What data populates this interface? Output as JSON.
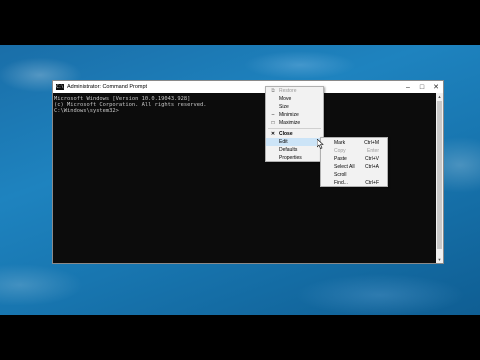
{
  "window": {
    "title": "Administrator: Command Prompt",
    "icon_text": "C:\\"
  },
  "console": {
    "lines": [
      "Microsoft Windows [Version 10.0.19043.928]",
      "(c) Microsoft Corporation. All rights reserved.",
      "",
      "C:\\Windows\\system32>"
    ]
  },
  "system_menu": {
    "items": [
      {
        "label": "Restore",
        "icon": "restore-icon",
        "glyph": "⧉",
        "disabled": true
      },
      {
        "label": "Move",
        "icon": "",
        "glyph": "",
        "disabled": false
      },
      {
        "label": "Size",
        "icon": "",
        "glyph": "",
        "disabled": false
      },
      {
        "label": "Minimize",
        "icon": "minimize-icon",
        "glyph": "–",
        "disabled": false
      },
      {
        "label": "Maximize",
        "icon": "maximize-icon",
        "glyph": "□",
        "disabled": false
      },
      {
        "label": "Close",
        "icon": "close-icon",
        "glyph": "✕",
        "disabled": false,
        "bold": true
      },
      {
        "label": "Edit",
        "icon": "",
        "glyph": "",
        "disabled": false,
        "submenu": true,
        "active": true
      },
      {
        "label": "Defaults",
        "icon": "",
        "glyph": "",
        "disabled": false
      },
      {
        "label": "Properties",
        "icon": "",
        "glyph": "",
        "disabled": false
      }
    ]
  },
  "edit_submenu": {
    "items": [
      {
        "label": "Mark",
        "shortcut": "Ctrl+M",
        "disabled": false
      },
      {
        "label": "Copy",
        "shortcut": "Enter",
        "disabled": true
      },
      {
        "label": "Paste",
        "shortcut": "Ctrl+V",
        "disabled": false
      },
      {
        "label": "Select All",
        "shortcut": "Ctrl+A",
        "disabled": false
      },
      {
        "label": "Scroll",
        "shortcut": "",
        "disabled": false
      },
      {
        "label": "Find...",
        "shortcut": "Ctrl+F",
        "disabled": false
      }
    ]
  },
  "colors": {
    "console_bg": "#0c0c0c",
    "console_text": "#c8c8c8",
    "menu_bg": "#f2f2f2",
    "menu_highlight": "#cce4f7",
    "desktop": "#1e83bf"
  }
}
